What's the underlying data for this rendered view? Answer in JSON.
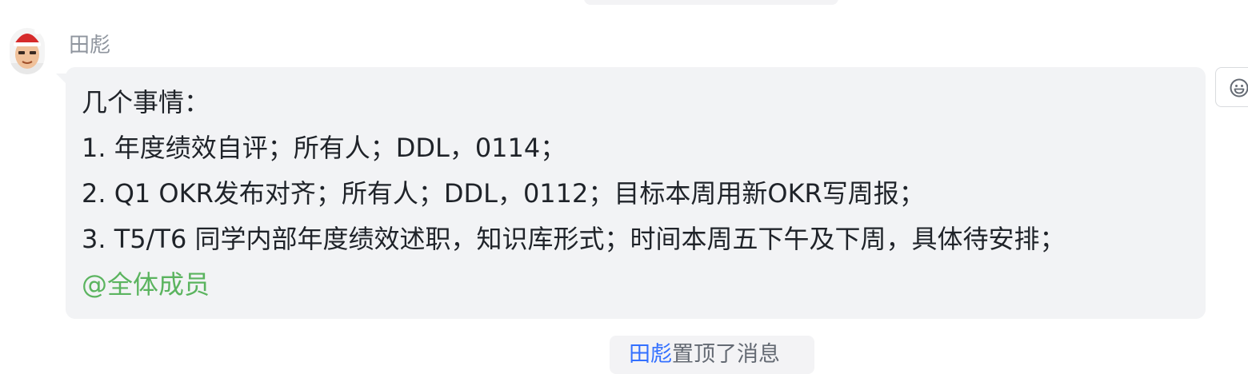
{
  "sender": {
    "name": "田彪"
  },
  "message": {
    "lines": [
      "几个事情：",
      "1. 年度绩效自评；所有人；DDL，0114；",
      "2. Q1 OKR发布对齐；所有人；DDL，0112；目标本周用新OKR写周报；",
      "3. T5/T6 同学内部年度绩效述职，知识库形式；时间本周五下午及下周，具体待安排；"
    ],
    "mention": "@全体成员"
  },
  "pin_notice": {
    "actor": "田彪",
    "action": "置顶了消息"
  },
  "colors": {
    "bubble_bg": "#f2f3f5",
    "mention": "#5bb45f",
    "link": "#3370ff",
    "secondary_text": "#8f959e"
  },
  "icons": {
    "reaction": "emoji-smile-icon",
    "avatar": "user-avatar"
  }
}
